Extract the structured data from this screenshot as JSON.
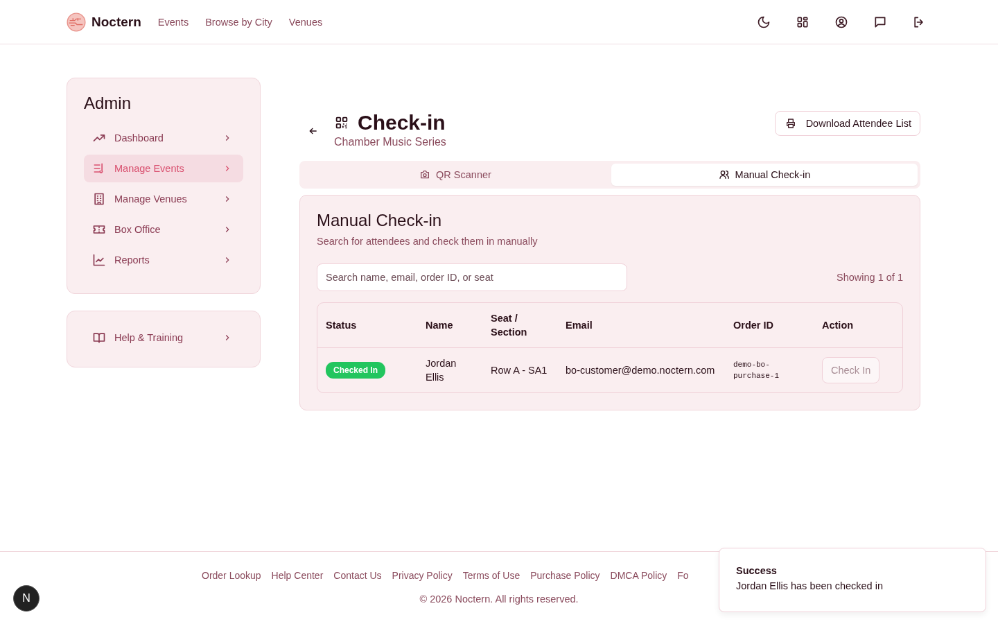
{
  "brand": "Noctern",
  "nav": [
    "Events",
    "Browse by City",
    "Venues"
  ],
  "sidebar": {
    "title": "Admin",
    "items": [
      {
        "label": "Dashboard",
        "selected": false
      },
      {
        "label": "Manage Events",
        "selected": true
      },
      {
        "label": "Manage Venues",
        "selected": false
      },
      {
        "label": "Box Office",
        "selected": false
      },
      {
        "label": "Reports",
        "selected": false
      }
    ],
    "help": "Help & Training"
  },
  "page": {
    "title": "Check-in",
    "subtitle": "Chamber Music Series",
    "download": "Download Attendee List"
  },
  "tabs": [
    {
      "label": "QR Scanner",
      "selected": false
    },
    {
      "label": "Manual Check-in",
      "selected": true
    }
  ],
  "panel": {
    "title": "Manual Check-in",
    "description": "Search for attendees and check them in manually",
    "search_placeholder": "Search name, email, order ID, or seat",
    "count": "Showing 1 of 1"
  },
  "table": {
    "columns": [
      "Status",
      "Name",
      "Seat / Section",
      "Email",
      "Order ID",
      "Action"
    ],
    "rows": [
      {
        "status": "Checked In",
        "checked_in": true,
        "name": "Jordan Ellis",
        "seat": "Row A - SA1",
        "email": "bo-customer@demo.noctern.com",
        "order_id": "demo-bo-purchase-1",
        "action": "Check In",
        "disabled": true
      }
    ]
  },
  "footer": {
    "links": [
      "Order Lookup",
      "Help Center",
      "Contact Us",
      "Privacy Policy",
      "Terms of Use",
      "Purchase Policy",
      "DMCA Policy",
      "Fo"
    ],
    "copyright": "© 2026 Noctern. All rights reserved."
  },
  "toast": {
    "title": "Success",
    "message": "Jordan Ellis has been checked in"
  },
  "avatar": "N"
}
